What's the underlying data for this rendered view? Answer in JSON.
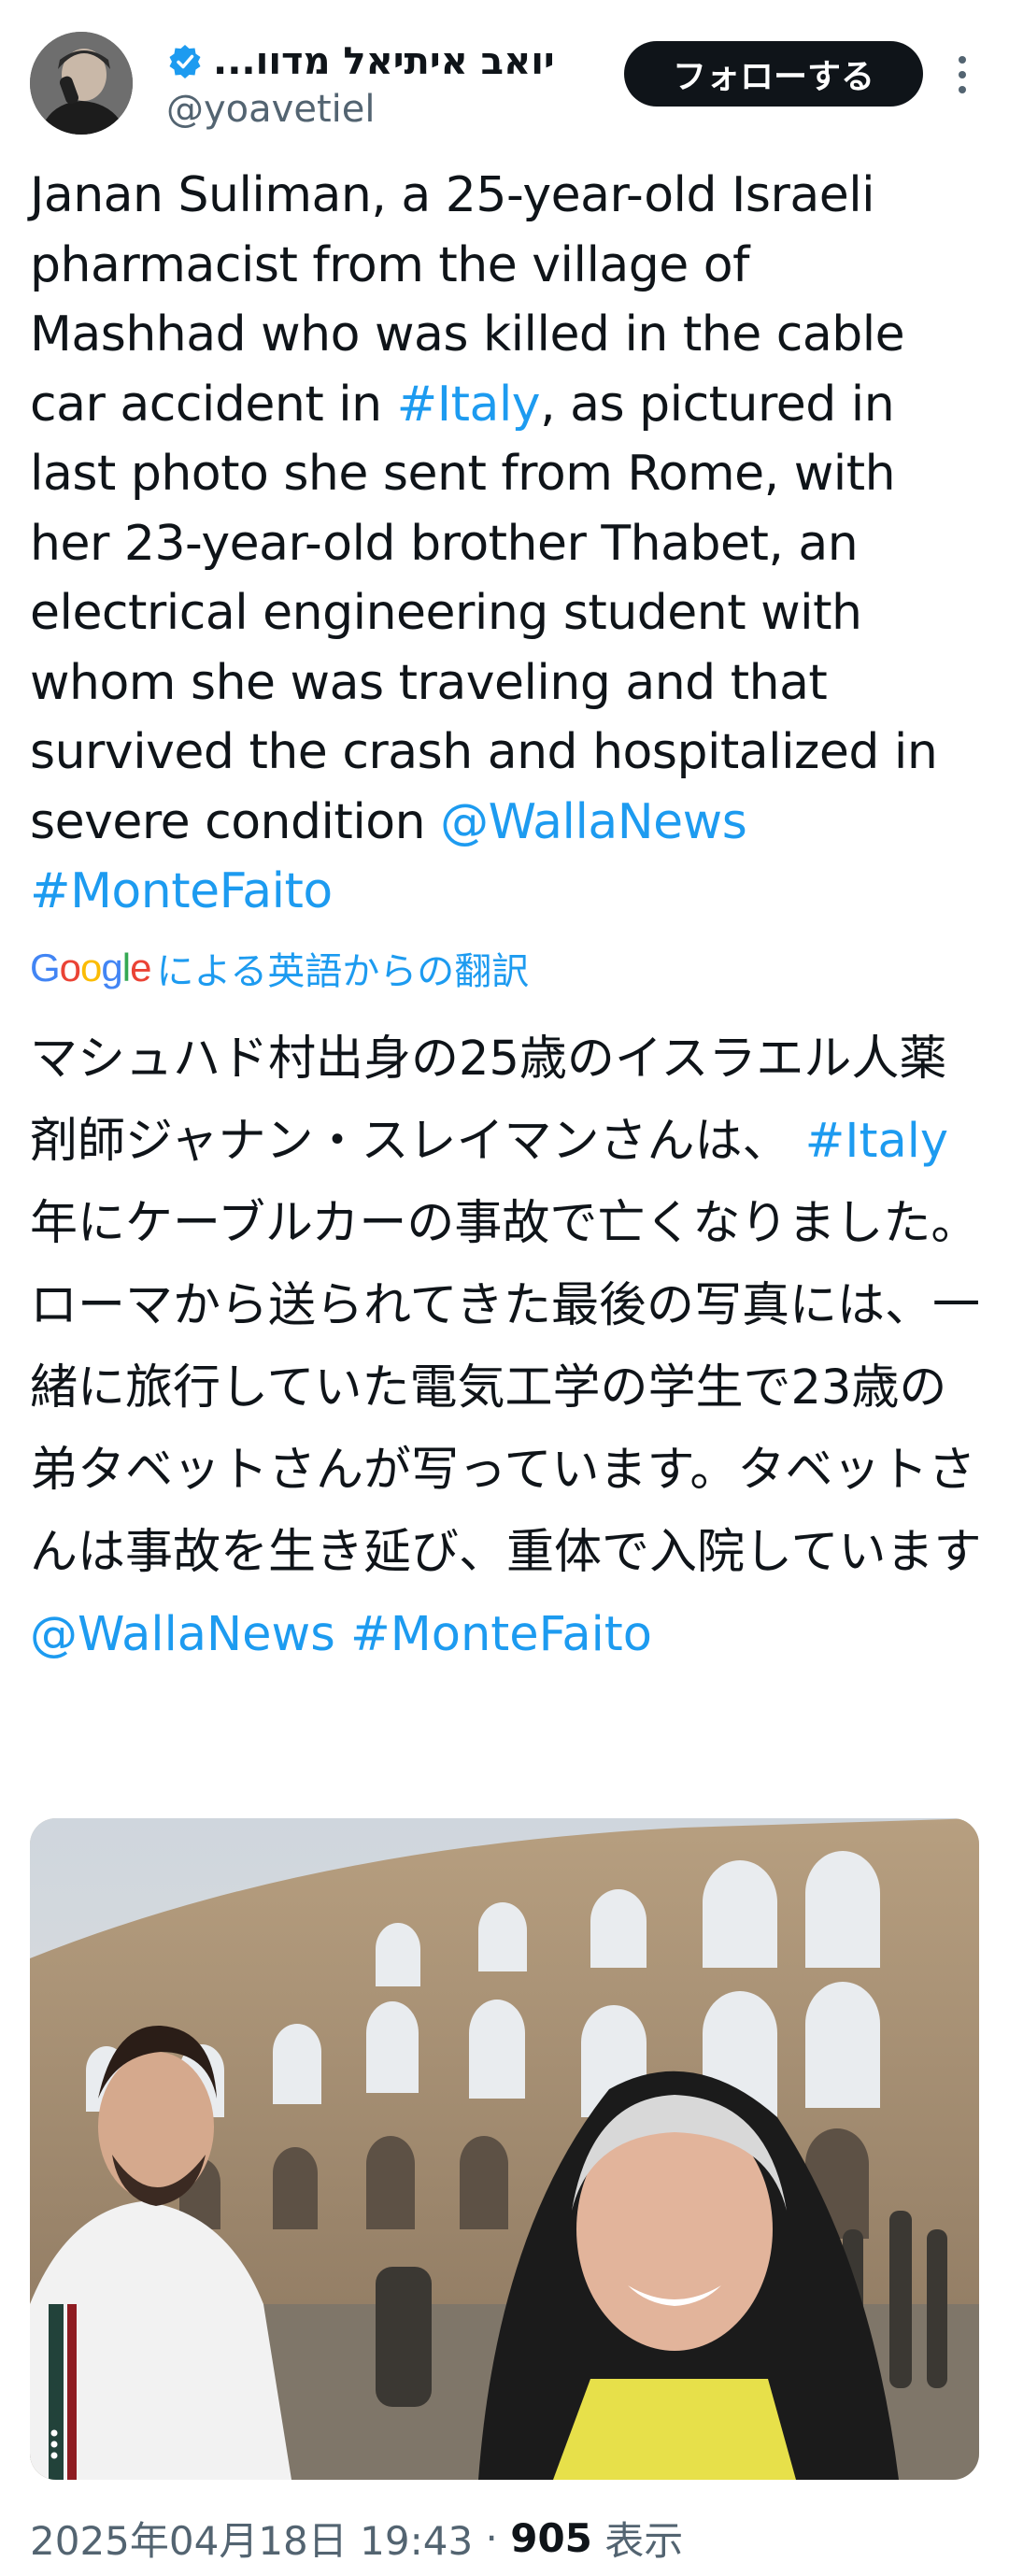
{
  "author": {
    "display_name": "יואב איתיאל מדוו...",
    "handle": "@yoavetiel",
    "verified": true,
    "verified_color": "#1d9bf0"
  },
  "follow_button": {
    "label": "フォローする"
  },
  "tweet": {
    "parts": [
      "Janan Suliman, a 25-year-old Israeli pharmacist from the village of Mashhad who was killed in the cable car accident in ",
      "#Italy",
      ", as pictured in last photo she sent from Rome, with her 23-year-old brother Thabet, an electrical engineering student with whom she was traveling and that survived the crash and hospitalized in severe condition ",
      "@WallaNews",
      " ",
      "#MonteFaito"
    ]
  },
  "translation": {
    "provider": "Google",
    "label": "による英語からの翻訳",
    "parts": [
      "マシュハド村出身の25歳のイスラエル人薬剤師ジャナン・スレイマンさんは、 ",
      "#Italy",
      "年にケーブルカーの事故で亡くなりました。ローマから送られてきた最後の写真には、一緒に旅行していた電気工学の学生で23歳の弟タベットさんが写っています。タベットさんは事故を生き延び、重体で入院しています",
      "@WallaNews",
      " ",
      "#MonteFaito"
    ]
  },
  "media": {
    "icon": "more-icon"
  },
  "footer": {
    "datetime": "2025年04月18日 19:43",
    "separator": " · ",
    "views_count": "905",
    "views_label": " 表示"
  },
  "colors": {
    "link": "#1d9bf0",
    "text": "#0f1419",
    "secondary": "#536471",
    "button_bg": "#0f1419"
  }
}
